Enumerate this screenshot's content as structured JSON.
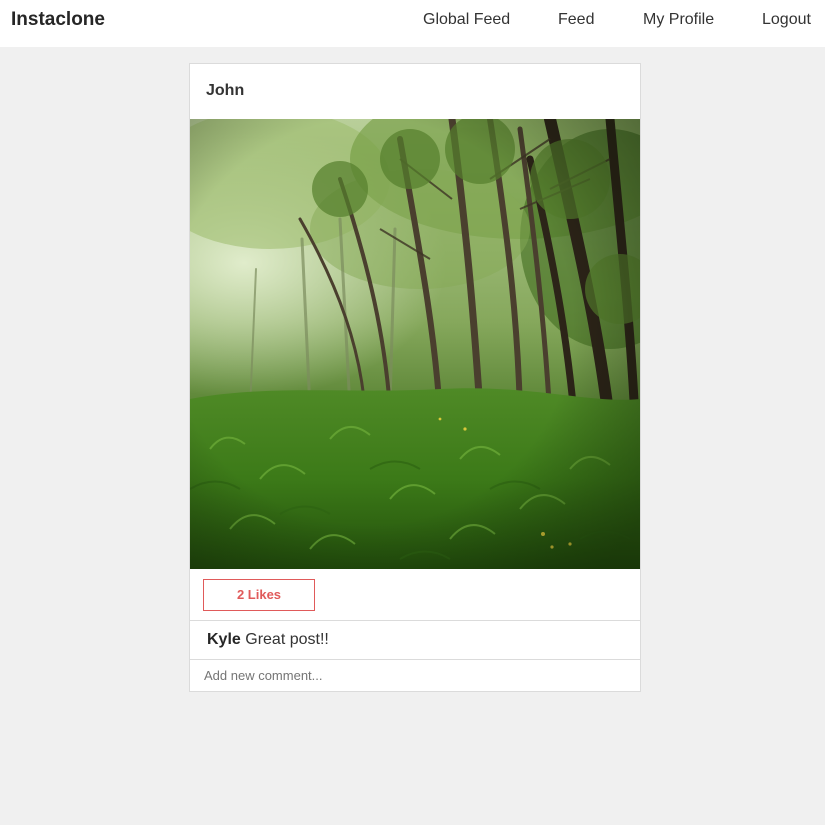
{
  "nav": {
    "brand": "Instaclone",
    "links": [
      "Global Feed",
      "Feed",
      "My Profile",
      "Logout"
    ]
  },
  "post": {
    "author": "John",
    "image_icon": "forest-photo",
    "likes_label": "2 Likes",
    "comments": [
      {
        "user": "Kyle",
        "text": "Great post!!"
      }
    ],
    "comment_placeholder": "Add new comment..."
  },
  "colors": {
    "page_background": "#f0f0f0",
    "card_background": "#ffffff",
    "like_accent": "#e05a5a",
    "border": "#dbdbdb"
  }
}
